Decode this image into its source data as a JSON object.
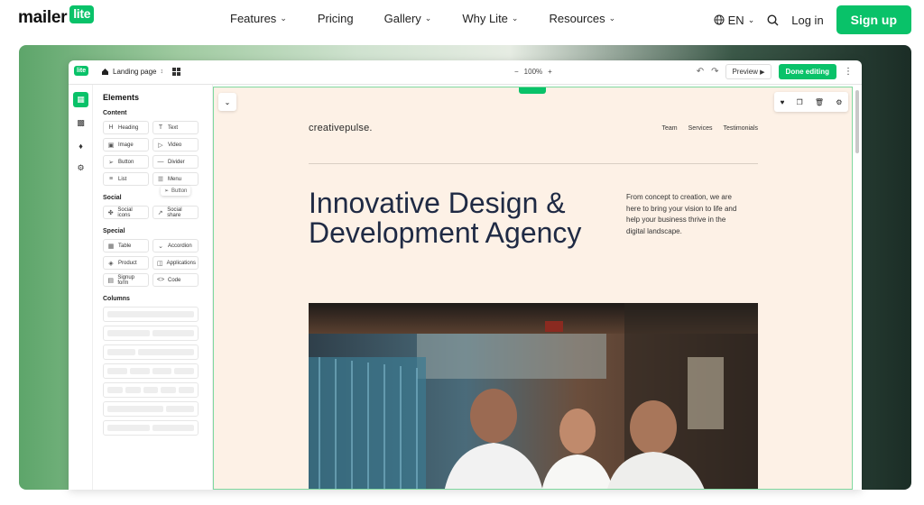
{
  "site_nav": {
    "logo_text": "mailer",
    "logo_badge": "lite",
    "links": [
      {
        "label": "Features",
        "has_dropdown": true
      },
      {
        "label": "Pricing",
        "has_dropdown": false
      },
      {
        "label": "Gallery",
        "has_dropdown": true
      },
      {
        "label": "Why Lite",
        "has_dropdown": true
      },
      {
        "label": "Resources",
        "has_dropdown": true
      }
    ],
    "language": "EN",
    "login_label": "Log in",
    "signup_label": "Sign up"
  },
  "editor": {
    "logo_badge": "lite",
    "page_name": "Landing page",
    "zoom": "100%",
    "zoom_minus": "−",
    "zoom_plus": "+",
    "preview_label": "Preview",
    "done_label": "Done editing"
  },
  "panel": {
    "title": "Elements",
    "sections": {
      "content": {
        "label": "Content",
        "items": [
          "Heading",
          "Text",
          "Image",
          "Video",
          "Button",
          "Divider",
          "List",
          "Menu"
        ]
      },
      "social": {
        "label": "Social",
        "items": [
          "Social icons",
          "Social share"
        ]
      },
      "special": {
        "label": "Special",
        "items": [
          "Table",
          "Accordion",
          "Product",
          "Applications",
          "Signup form",
          "Code"
        ]
      },
      "columns": {
        "label": "Columns"
      }
    },
    "drag_ghost_label": "Button"
  },
  "canvas": {
    "brand": "creativepulse.",
    "nav": [
      "Team",
      "Services",
      "Testimonials"
    ],
    "headline": "Innovative Design & Development Agency",
    "subcopy": "From concept to creation, we are here to bring your vision to life and help your business thrive in the digital landscape."
  },
  "colors": {
    "brand_green": "#09c269",
    "canvas_bg": "#fdf1e6",
    "headline": "#1f2a44"
  }
}
